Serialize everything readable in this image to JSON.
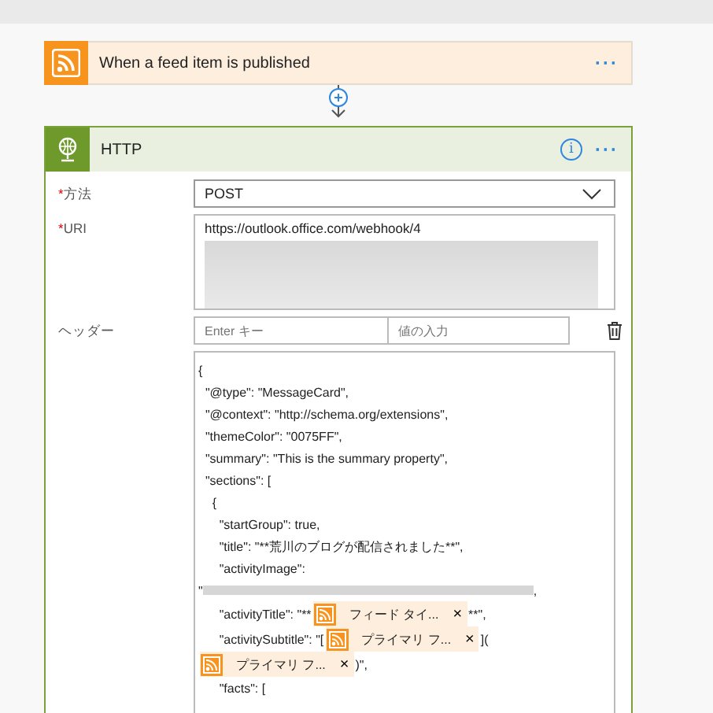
{
  "trigger": {
    "title": "When a feed item is published",
    "more": "···"
  },
  "action": {
    "title": "HTTP",
    "info": "i",
    "more": "···",
    "fields": [
      {
        "kind": "select",
        "marker": "*",
        "label": "方法",
        "value": "POST"
      },
      {
        "kind": "uri",
        "marker": "*",
        "label": "URI",
        "value": "https://outlook.office.com/webhook/4"
      },
      {
        "kind": "pair",
        "label": "ヘッダー",
        "key_placeholder": "Enter キー",
        "value_placeholder": "値の入力"
      }
    ],
    "body": [
      [
        {
          "kind": "text",
          "text": "{"
        }
      ],
      [
        {
          "kind": "text",
          "text": "  \"@type\": \"MessageCard\","
        }
      ],
      [
        {
          "kind": "text",
          "text": "  \"@context\": \"http://schema.org/extensions\","
        }
      ],
      [
        {
          "kind": "text",
          "text": "  \"themeColor\": \"0075FF\","
        }
      ],
      [
        {
          "kind": "text",
          "text": "  \"summary\": \"This is the summary property\","
        }
      ],
      [
        {
          "kind": "text",
          "text": "  \"sections\": ["
        }
      ],
      [
        {
          "kind": "text",
          "text": "    {"
        }
      ],
      [
        {
          "kind": "text",
          "text": "      \"startGroup\": true,"
        }
      ],
      [
        {
          "kind": "text",
          "text": "      \"title\": \"**荒川のブログが配信されました**\","
        }
      ],
      [
        {
          "kind": "text",
          "text": "      \"activityImage\":"
        }
      ],
      [
        {
          "kind": "text",
          "text": "\""
        },
        {
          "kind": "redacted"
        },
        {
          "kind": "text",
          "text": ","
        }
      ],
      [
        {
          "kind": "text",
          "text": "      \"activityTitle\": \"**"
        },
        {
          "kind": "token",
          "label": "フィード タイ...",
          "remove": "×"
        },
        {
          "kind": "text",
          "text": "**\","
        }
      ],
      [
        {
          "kind": "text",
          "text": "      \"activitySubtitle\": \"["
        },
        {
          "kind": "token",
          "label": "プライマリ フ...",
          "remove": "×"
        },
        {
          "kind": "text",
          "text": "]("
        }
      ],
      [
        {
          "kind": "token",
          "label": "プライマリ フ...",
          "remove": "×"
        },
        {
          "kind": "text",
          "text": ")\","
        }
      ],
      [
        {
          "kind": "text",
          "text": "      \"facts\": ["
        }
      ]
    ]
  }
}
